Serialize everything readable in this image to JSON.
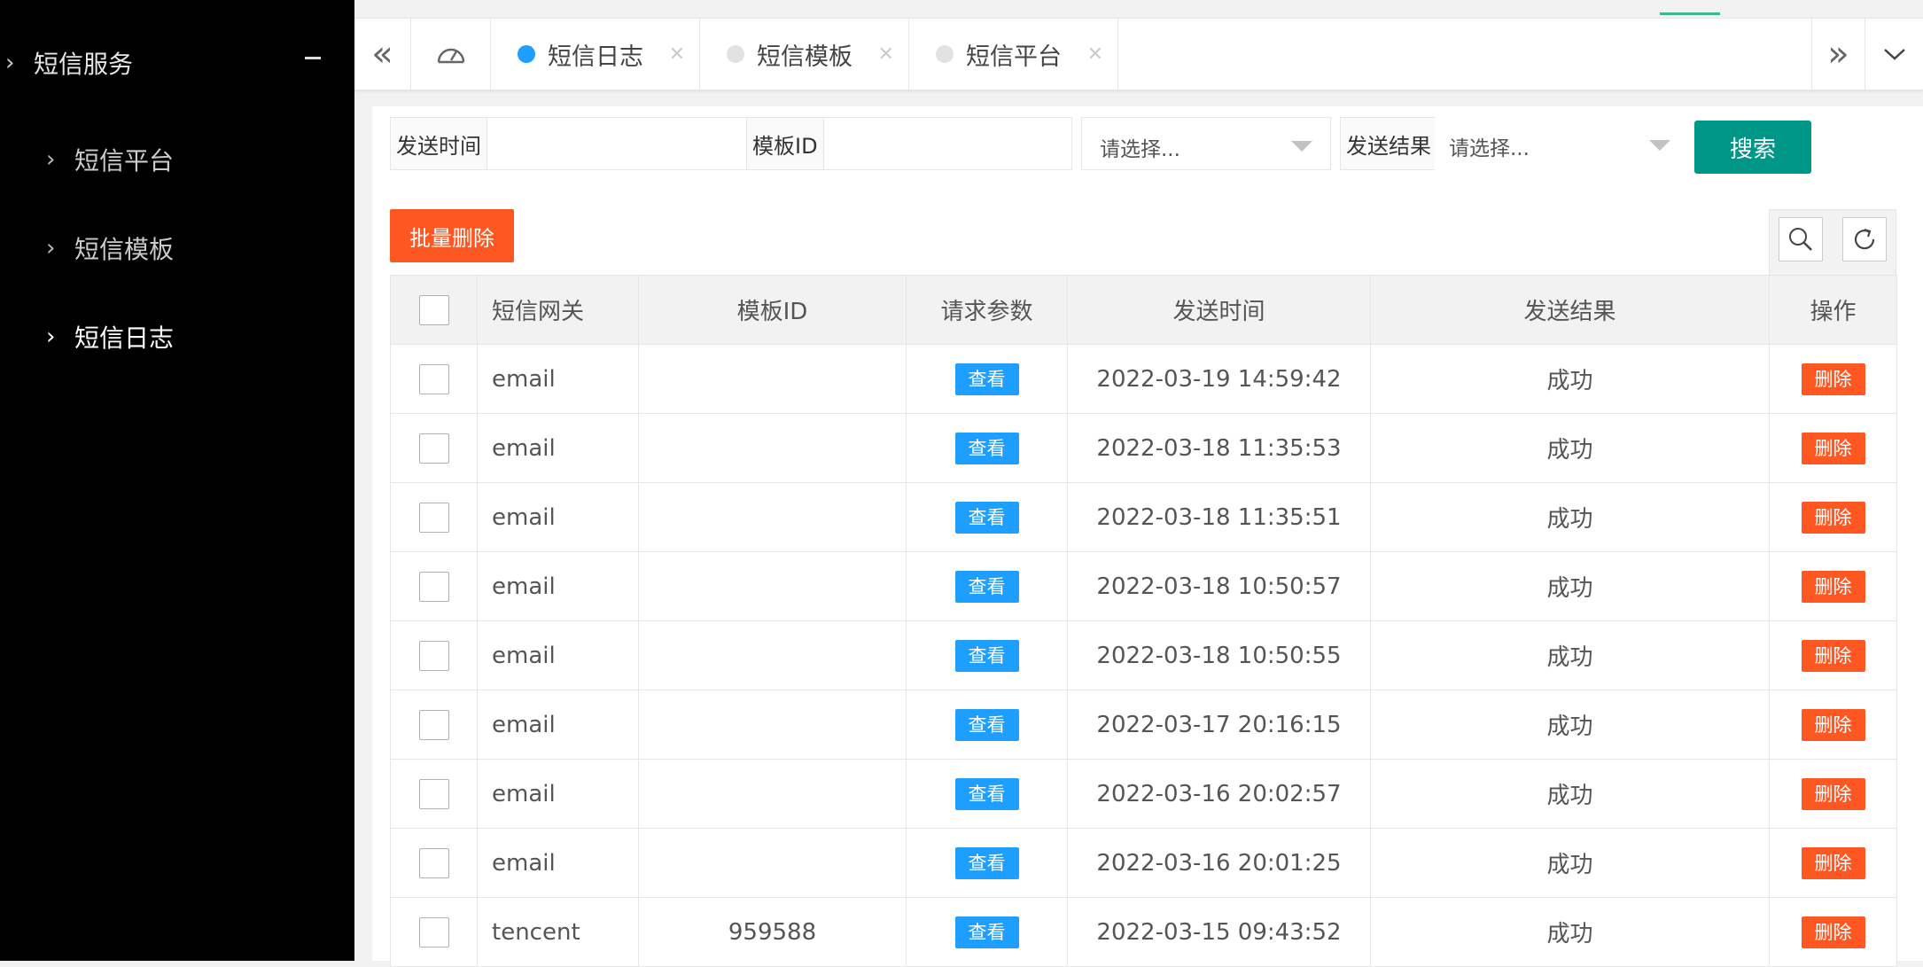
{
  "sidebar": {
    "group_label": "短信服务",
    "items": [
      {
        "label": "短信平台"
      },
      {
        "label": "短信模板"
      },
      {
        "label": "短信日志"
      }
    ]
  },
  "tabs": [
    {
      "label": "短信日志",
      "active": true
    },
    {
      "label": "短信模板",
      "active": false
    },
    {
      "label": "短信平台",
      "active": false
    }
  ],
  "search": {
    "send_time_label": "发送时间",
    "send_time_value": "",
    "template_id_label": "模板ID",
    "template_id_value": "",
    "select1_placeholder": "请选择...",
    "result_label": "发送结果",
    "result_placeholder": "请选择...",
    "search_button": "搜索"
  },
  "toolbar": {
    "batch_delete": "批量删除"
  },
  "table": {
    "columns": [
      "短信网关",
      "模板ID",
      "请求参数",
      "发送时间",
      "发送结果",
      "操作"
    ],
    "view_label": "查看",
    "delete_label": "删除",
    "rows": [
      {
        "gateway": "email",
        "template_id": "",
        "time": "2022-03-19 14:59:42",
        "result": "成功"
      },
      {
        "gateway": "email",
        "template_id": "",
        "time": "2022-03-18 11:35:53",
        "result": "成功"
      },
      {
        "gateway": "email",
        "template_id": "",
        "time": "2022-03-18 11:35:51",
        "result": "成功"
      },
      {
        "gateway": "email",
        "template_id": "",
        "time": "2022-03-18 10:50:57",
        "result": "成功"
      },
      {
        "gateway": "email",
        "template_id": "",
        "time": "2022-03-18 10:50:55",
        "result": "成功"
      },
      {
        "gateway": "email",
        "template_id": "",
        "time": "2022-03-17 20:16:15",
        "result": "成功"
      },
      {
        "gateway": "email",
        "template_id": "",
        "time": "2022-03-16 20:02:57",
        "result": "成功"
      },
      {
        "gateway": "email",
        "template_id": "",
        "time": "2022-03-16 20:01:25",
        "result": "成功"
      },
      {
        "gateway": "tencent",
        "template_id": "959588",
        "time": "2022-03-15 09:43:52",
        "result": "成功"
      }
    ]
  },
  "colors": {
    "primary": "#009688",
    "info": "#1e9fff",
    "danger": "#ff5722",
    "sidebar_bg": "#000000"
  }
}
